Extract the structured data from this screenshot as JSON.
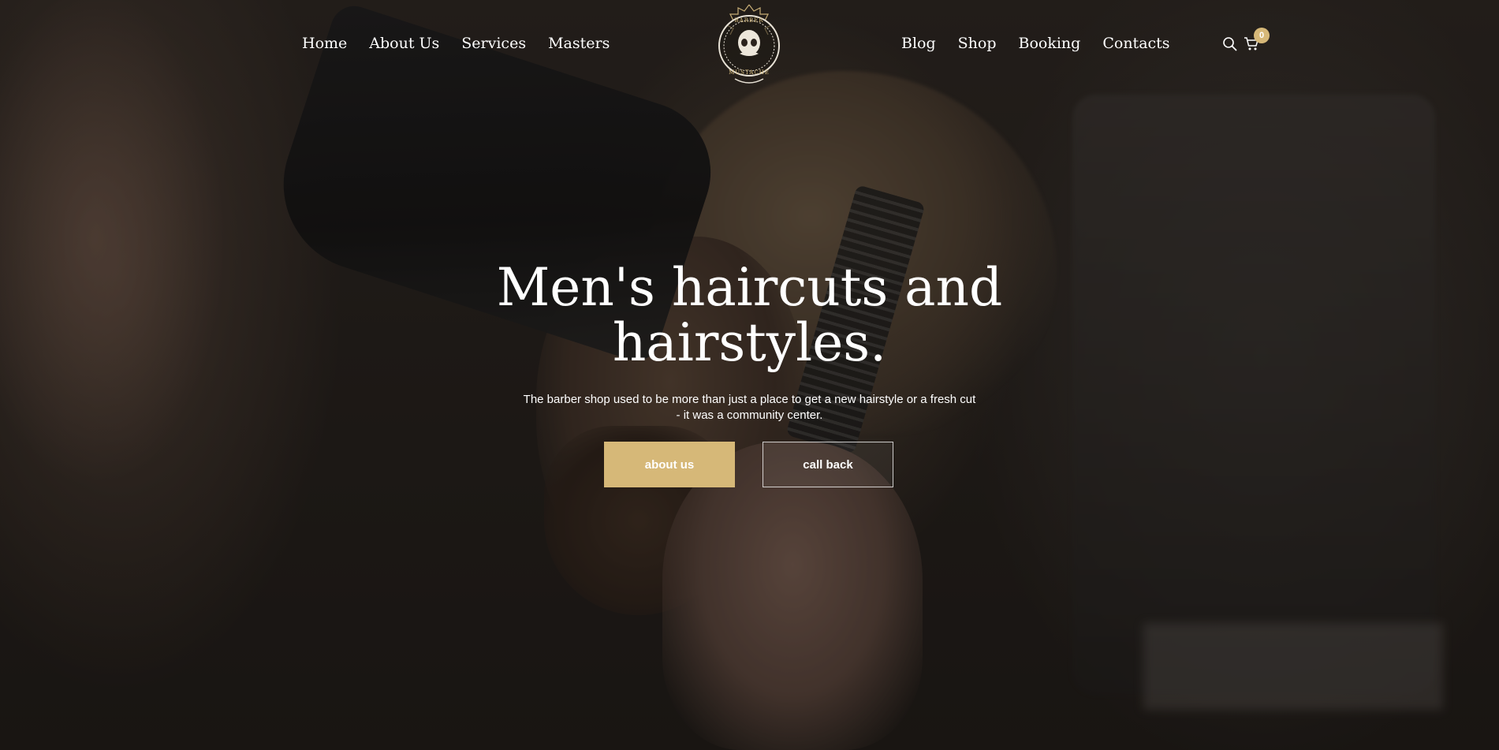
{
  "nav": {
    "left": [
      "Home",
      "About Us",
      "Services",
      "Masters"
    ],
    "right": [
      "Blog",
      "Shop",
      "Booking",
      "Contacts"
    ]
  },
  "logo": {
    "top_text": "BARBER",
    "bottom_text": "MUSTACHE"
  },
  "header_icons": {
    "search": "search-icon",
    "cart": "cart-icon",
    "cart_count": "0"
  },
  "hero": {
    "title_line1": "Men's haircuts and",
    "title_line2": "hairstyles.",
    "subtitle": "The barber shop used to be more than just a place to get a new hairstyle or a fresh cut - it was a community center.",
    "primary_button": "about us",
    "secondary_button": "call back"
  },
  "colors": {
    "accent": "#d6b878",
    "text": "#ffffff"
  }
}
